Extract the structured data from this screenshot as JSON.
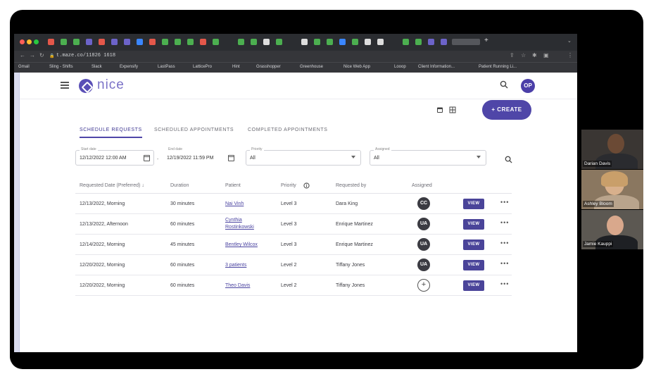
{
  "browser": {
    "url": "t.maze.co/11826 1618",
    "bookmarks": [
      "Gmail",
      "Sling - Shifts",
      "Slack",
      "Expensify",
      "LastPass",
      "LatticePro",
      "Hint",
      "Grasshopper",
      "Greenhouse",
      "Nice Web App",
      "Looop",
      "Client Information...",
      "Patient Running Li..."
    ]
  },
  "header": {
    "logo_text": "nice",
    "avatar_initials": "OP"
  },
  "toolbar": {
    "create_label": "+ CREATE"
  },
  "tabs": [
    {
      "label": "SCHEDULE REQUESTS",
      "active": true
    },
    {
      "label": "SCHEDULED APPOINTMENTS",
      "active": false
    },
    {
      "label": "COMPLETED APPOINTMENTS",
      "active": false
    }
  ],
  "filters": {
    "start_label": "Start date",
    "start_value": "12/12/2022 12:00 AM",
    "end_label": "End date",
    "end_value": "12/19/2022 11:59 PM",
    "priority_label": "Priority",
    "priority_value": "All",
    "assigned_label": "Assigned",
    "assigned_value": "All"
  },
  "table": {
    "headers": [
      "Requested Date (Preferred) ↓",
      "Duration",
      "Patient",
      "Priority",
      "Requested by",
      "Assigned"
    ],
    "rows": [
      {
        "date": "12/13/2022, Morning",
        "duration": "30 minutes",
        "patient": "Nai Vinh",
        "patient2": "",
        "priority": "Level 3",
        "requested_by": "Dara King",
        "assigned": "CC",
        "view": "VIEW"
      },
      {
        "date": "12/13/2022, Afternoon",
        "duration": "60 minutes",
        "patient": "Cynthia",
        "patient2": "Rostinkowski",
        "priority": "Level 3",
        "requested_by": "Enrique Martinez",
        "assigned": "UA",
        "view": "VIEW"
      },
      {
        "date": "12/14/2022, Morning",
        "duration": "45 minutes",
        "patient": "Bentley Wilcox",
        "patient2": "",
        "priority": "Level 3",
        "requested_by": "Enrique Martinez",
        "assigned": "UA",
        "view": "VIEW"
      },
      {
        "date": "12/20/2022, Morning",
        "duration": "60 minutes",
        "patient": "3 patients",
        "patient2": "",
        "priority": "Level 2",
        "requested_by": "Tiffany Jones",
        "assigned": "UA",
        "view": "VIEW"
      },
      {
        "date": "12/20/2022, Morning",
        "duration": "60 minutes",
        "patient": "Theo Davis",
        "patient2": "",
        "priority": "Level 2",
        "requested_by": "Tiffany Jones",
        "assigned": "+",
        "view": "VIEW"
      }
    ],
    "more_label": "•••"
  },
  "participants": [
    {
      "name": "Darian Davis"
    },
    {
      "name": "Ashley Bloom"
    },
    {
      "name": "Jamie Kauppi"
    }
  ]
}
